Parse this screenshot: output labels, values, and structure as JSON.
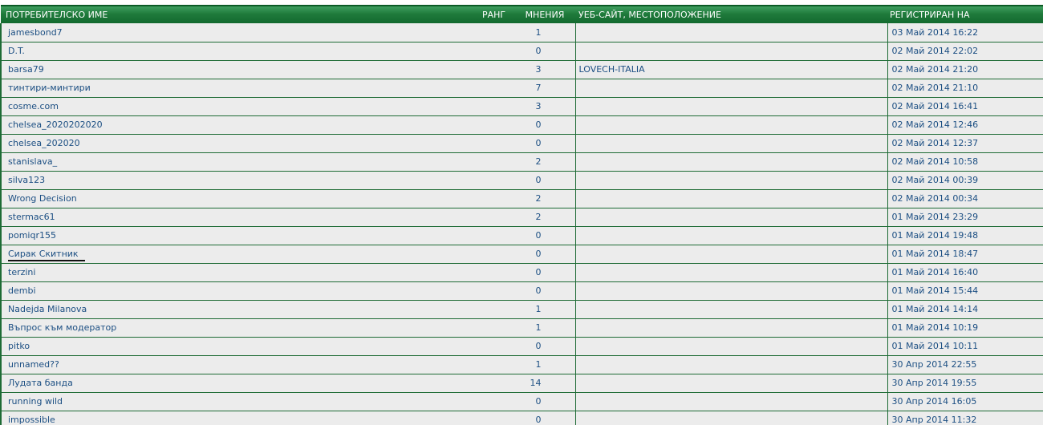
{
  "columns": {
    "username": "ПОТРЕБИТЕЛСКО ИМЕ",
    "rank": "РАНГ",
    "posts": "МНЕНИЯ",
    "site": "УЕБ-САЙТ, МЕСТОПОЛОЖЕНИЕ",
    "registered": "РЕГИСТРИРАН НА"
  },
  "colors": {
    "header_green": "#1f7a3b",
    "row_background": "#ececec",
    "link_blue": "#1c4f83",
    "row_border": "#1e6b35"
  },
  "rows": [
    {
      "username": "jamesbond7",
      "rank": "",
      "posts": "1",
      "site": "",
      "registered": "03 Май 2014 16:22"
    },
    {
      "username": "D.T.",
      "rank": "",
      "posts": "0",
      "site": "",
      "registered": "02 Май 2014 22:02"
    },
    {
      "username": "barsa79",
      "rank": "",
      "posts": "3",
      "site": "LOVECH-ITALIA",
      "registered": "02 Май 2014 21:20"
    },
    {
      "username": "тинтири-минтири",
      "rank": "",
      "posts": "7",
      "site": "",
      "registered": "02 Май 2014 21:10"
    },
    {
      "username": "cosme.com",
      "rank": "",
      "posts": "3",
      "site": "",
      "registered": "02 Май 2014 16:41"
    },
    {
      "username": "chelsea_2020202020",
      "rank": "",
      "posts": "0",
      "site": "",
      "registered": "02 Май 2014 12:46"
    },
    {
      "username": "chelsea_202020",
      "rank": "",
      "posts": "0",
      "site": "",
      "registered": "02 Май 2014 12:37"
    },
    {
      "username": "stanislava_",
      "rank": "",
      "posts": "2",
      "site": "",
      "registered": "02 Май 2014 10:58"
    },
    {
      "username": "silva123",
      "rank": "",
      "posts": "0",
      "site": "",
      "registered": "02 Май 2014 00:39"
    },
    {
      "username": "Wrong Decision",
      "rank": "",
      "posts": "2",
      "site": "",
      "registered": "02 Май 2014 00:34"
    },
    {
      "username": "stermac61",
      "rank": "",
      "posts": "2",
      "site": "",
      "registered": "01 Май 2014 23:29"
    },
    {
      "username": "pomiqr155",
      "rank": "",
      "posts": "0",
      "site": "",
      "registered": "01 Май 2014 19:48"
    },
    {
      "username": "Сирак Скитник",
      "rank": "",
      "posts": "0",
      "site": "",
      "registered": "01 Май 2014 18:47",
      "underlined": true
    },
    {
      "username": "terzini",
      "rank": "",
      "posts": "0",
      "site": "",
      "registered": "01 Май 2014 16:40"
    },
    {
      "username": "dembi",
      "rank": "",
      "posts": "0",
      "site": "",
      "registered": "01 Май 2014 15:44"
    },
    {
      "username": "Nadejda Milanova",
      "rank": "",
      "posts": "1",
      "site": "",
      "registered": "01 Май 2014 14:14"
    },
    {
      "username": "Въпрос към модератор",
      "rank": "",
      "posts": "1",
      "site": "",
      "registered": "01 Май 2014 10:19"
    },
    {
      "username": "pitko",
      "rank": "",
      "posts": "0",
      "site": "",
      "registered": "01 Май 2014 10:11"
    },
    {
      "username": "unnamed??",
      "rank": "",
      "posts": "1",
      "site": "",
      "registered": "30 Апр 2014 22:55"
    },
    {
      "username": "Лудата банда",
      "rank": "",
      "posts": "14",
      "site": "",
      "registered": "30 Апр 2014 19:55"
    },
    {
      "username": "running wild",
      "rank": "",
      "posts": "0",
      "site": "",
      "registered": "30 Апр 2014 16:05"
    },
    {
      "username": "impossible",
      "rank": "",
      "posts": "0",
      "site": "",
      "registered": "30 Апр 2014 11:32"
    }
  ]
}
